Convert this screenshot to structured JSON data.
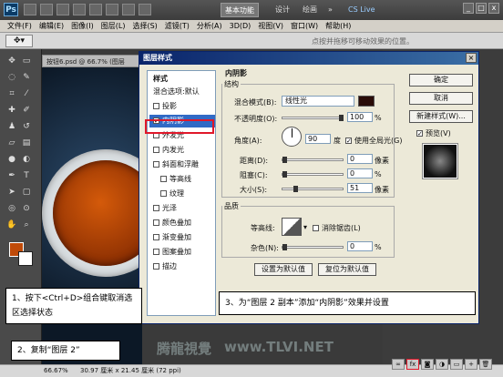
{
  "app": {
    "logo": "Ps",
    "workspaces": [
      "基本功能",
      "设计",
      "绘画"
    ],
    "active_workspace": "基本功能",
    "cslive": "CS Live",
    "win_buttons": [
      "_",
      "□",
      "x"
    ]
  },
  "menu": [
    "文件(F)",
    "编辑(E)",
    "图像(I)",
    "图层(L)",
    "选择(S)",
    "滤镜(T)",
    "分析(A)",
    "3D(D)",
    "视图(V)",
    "窗口(W)",
    "帮助(H)"
  ],
  "options": {
    "hint": "点按并拖移可移动效果的位置。"
  },
  "document": {
    "tab": "按钮6.psd @ 66.7% (图层",
    "zoom": "66.67%",
    "size": "30.97 厘米 x 21.45 厘米 (72 ppi)"
  },
  "dialog": {
    "title": "图层样式",
    "style_list": {
      "header": "样式",
      "items": [
        {
          "label": "混合选项:默认",
          "checkbox": false,
          "checked": false
        },
        {
          "label": "投影",
          "checkbox": true,
          "checked": false
        },
        {
          "label": "内阴影",
          "checkbox": true,
          "checked": true,
          "selected": true
        },
        {
          "label": "外发光",
          "checkbox": true,
          "checked": false
        },
        {
          "label": "内发光",
          "checkbox": true,
          "checked": false
        },
        {
          "label": "斜面和浮雕",
          "checkbox": true,
          "checked": false
        },
        {
          "label": "等高线",
          "checkbox": true,
          "checked": false
        },
        {
          "label": "纹理",
          "checkbox": true,
          "checked": false
        },
        {
          "label": "光泽",
          "checkbox": true,
          "checked": false
        },
        {
          "label": "颜色叠加",
          "checkbox": true,
          "checked": false
        },
        {
          "label": "渐变叠加",
          "checkbox": true,
          "checked": false
        },
        {
          "label": "图案叠加",
          "checkbox": true,
          "checked": false
        },
        {
          "label": "描边",
          "checkbox": true,
          "checked": false
        }
      ]
    },
    "inner_shadow": {
      "group_title": "内阴影",
      "structure_title": "结构",
      "blend_mode_label": "混合模式(B):",
      "blend_mode_value": "线性光",
      "shadow_color": "#2a0c08",
      "opacity_label": "不透明度(O):",
      "opacity_value": "100",
      "opacity_unit": "%",
      "angle_label": "角度(A):",
      "angle_value": "90",
      "angle_unit": "度",
      "global_light_label": "使用全局光(G)",
      "global_light_checked": true,
      "distance_label": "距离(D):",
      "distance_value": "0",
      "distance_unit": "像素",
      "choke_label": "阻塞(C):",
      "choke_value": "0",
      "choke_unit": "%",
      "size_label": "大小(S):",
      "size_value": "51",
      "size_unit": "像素",
      "quality_title": "品质",
      "contour_label": "等高线:",
      "antialias_label": "消除锯齿(L)",
      "noise_label": "杂色(N):",
      "noise_value": "0",
      "noise_unit": "%",
      "default_btn": "设置为默认值",
      "reset_btn": "复位为默认值"
    },
    "buttons": {
      "ok": "确定",
      "cancel": "取消",
      "new_style": "新建样式(W)...",
      "preview_label": "预览(V)"
    }
  },
  "callouts": {
    "step1": "1、按下<Ctrl+D>组合键取消选区选择状态",
    "step2": "2、复制“图层 2”",
    "step3": "3、为“图层 2 副本”添加“内阴影”效果并设置"
  },
  "watermark": "www.TLVI.NET",
  "watermark_cn": "腾龍視覺"
}
